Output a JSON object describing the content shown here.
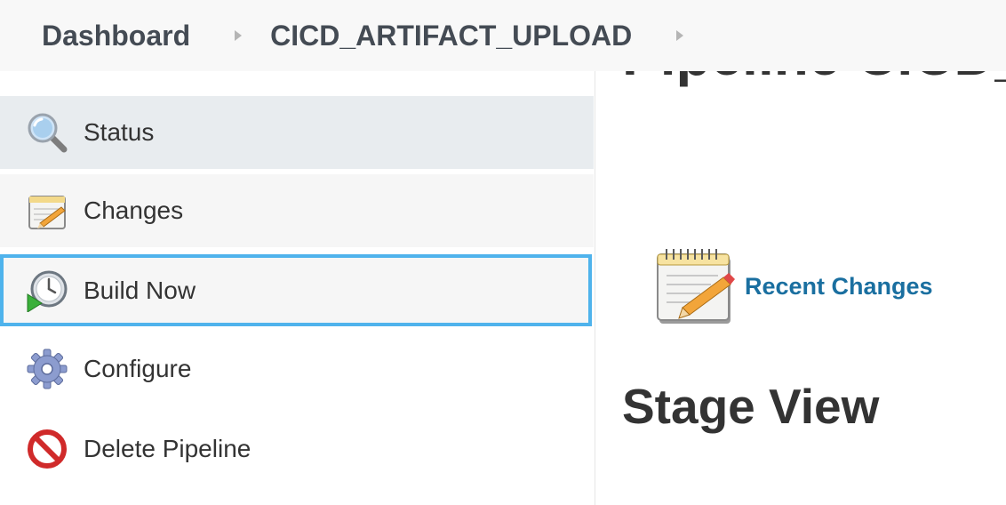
{
  "breadcrumb": {
    "items": [
      "Dashboard",
      "CICD_ARTIFACT_UPLOAD"
    ]
  },
  "sidebar": {
    "items": [
      {
        "label": "Status",
        "icon": "search-icon"
      },
      {
        "label": "Changes",
        "icon": "notepad-icon"
      },
      {
        "label": "Build Now",
        "icon": "clock-play-icon"
      },
      {
        "label": "Configure",
        "icon": "gear-icon"
      },
      {
        "label": "Delete Pipeline",
        "icon": "no-entry-icon"
      }
    ]
  },
  "main": {
    "title": "Pipeline CICD_",
    "recent_changes": "Recent Changes",
    "stage_view": "Stage View"
  },
  "colors": {
    "link": "#1a6fa0",
    "focus_outline": "#4fb3ec",
    "status_bg": "#e8ecef",
    "breadcrumb_bg": "#f8f8f8"
  }
}
